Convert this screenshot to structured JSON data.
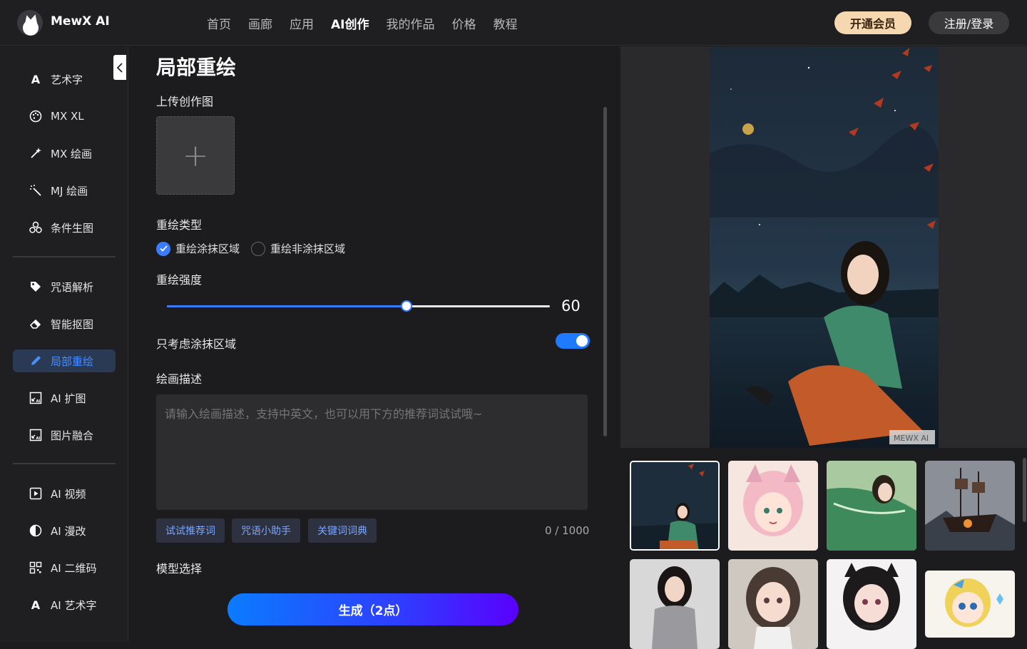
{
  "header": {
    "brand": "MewX AI",
    "nav": [
      "首页",
      "画廊",
      "应用",
      "AI创作",
      "我的作品",
      "价格",
      "教程"
    ],
    "active_nav": "AI创作",
    "vip_label": "开通会员",
    "login_label": "注册/登录"
  },
  "sidebar": {
    "items": [
      {
        "label": "艺术字",
        "icon": "letter-a-icon"
      },
      {
        "label": "MX XL",
        "icon": "palette-icon"
      },
      {
        "label": "MX 绘画",
        "icon": "magic-wand-icon"
      },
      {
        "label": "MJ 绘画",
        "icon": "sparkle-wand-icon"
      },
      {
        "label": "条件生图",
        "icon": "nodes-icon"
      },
      {
        "label": "咒语解析",
        "icon": "tag-icon"
      },
      {
        "label": "智能抠图",
        "icon": "eraser-icon"
      },
      {
        "label": "局部重绘",
        "icon": "pencil-icon",
        "active": true
      },
      {
        "label": "AI 扩图",
        "icon": "expand-image-icon"
      },
      {
        "label": "图片融合",
        "icon": "merge-image-icon"
      },
      {
        "label": "AI 视频",
        "icon": "video-play-icon"
      },
      {
        "label": "AI 漫改",
        "icon": "half-circle-icon"
      },
      {
        "label": "AI 二维码",
        "icon": "qrcode-icon"
      },
      {
        "label": "AI 艺术字",
        "icon": "letter-a-icon"
      }
    ]
  },
  "panel": {
    "title": "局部重绘",
    "upload_label": "上传创作图",
    "upload_plus": "+",
    "redraw_type_label": "重绘类型",
    "redraw_options": [
      "重绘涂抹区域",
      "重绘非涂抹区域"
    ],
    "redraw_selected": 0,
    "strength_label": "重绘强度",
    "strength_value": "60",
    "strength_fraction": 0.625,
    "only_mask_label": "只考虑涂抹区域",
    "only_mask_on": true,
    "prompt_label": "绘画描述",
    "prompt_placeholder": "请输入绘画描述，支持中英文，也可以用下方的推荐词试试哦~",
    "chips": [
      "试试推荐词",
      "咒语小助手",
      "关键词词典"
    ],
    "counter": "0 / 1000",
    "model_label": "模型选择",
    "generate_label": "生成（2点）"
  },
  "preview": {
    "watermark": "MEWX AI"
  },
  "colors": {
    "accent": "#3a7bff",
    "vip": "#f6d8b0",
    "background": "#1c1c1e"
  }
}
